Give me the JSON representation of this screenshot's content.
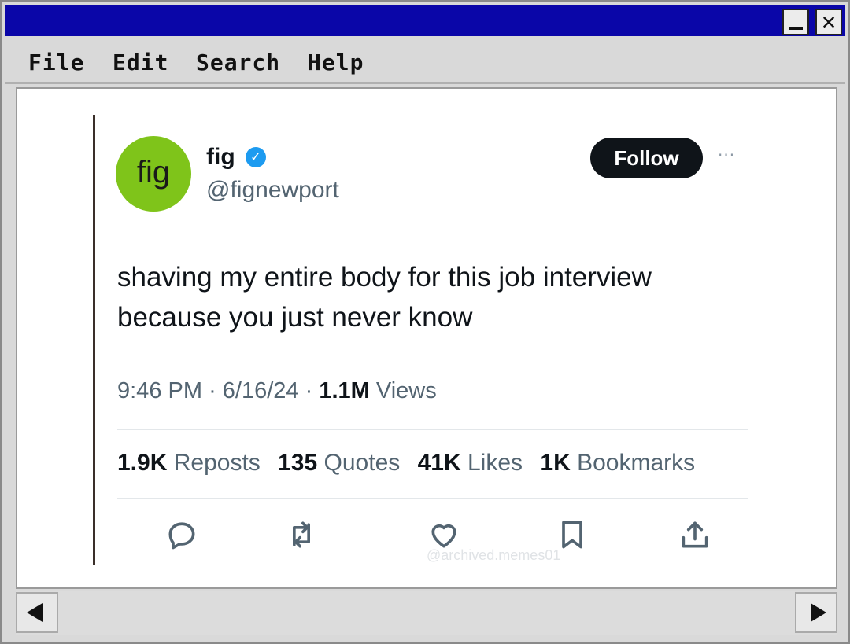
{
  "window": {
    "controls": {
      "minimize": "_",
      "close": "✕"
    },
    "menu": [
      "File",
      "Edit",
      "Search",
      "Help"
    ]
  },
  "tweet": {
    "avatar_text": "fig",
    "display_name": "fig",
    "handle": "@fignewport",
    "follow_label": "Follow",
    "more_label": "···",
    "text_line1": "shaving my entire body for this job interview",
    "text_line2": "because you just never know",
    "time": "9:46 PM",
    "date": "6/16/24",
    "views_count": "1.1M",
    "views_label": "Views",
    "separator": "·",
    "stats": [
      {
        "count": "1.9K",
        "label": "Reposts"
      },
      {
        "count": "135",
        "label": "Quotes"
      },
      {
        "count": "41K",
        "label": "Likes"
      },
      {
        "count": "1K",
        "label": "Bookmarks"
      }
    ],
    "watermark": "@archived.memes01",
    "accent_color": "#1d9bf0",
    "avatar_color": "#7fc41a"
  },
  "actions": [
    "reply-icon",
    "repost-icon",
    "like-icon",
    "bookmark-icon",
    "share-icon"
  ],
  "scroll": {
    "left": "◀",
    "right": "▶"
  }
}
